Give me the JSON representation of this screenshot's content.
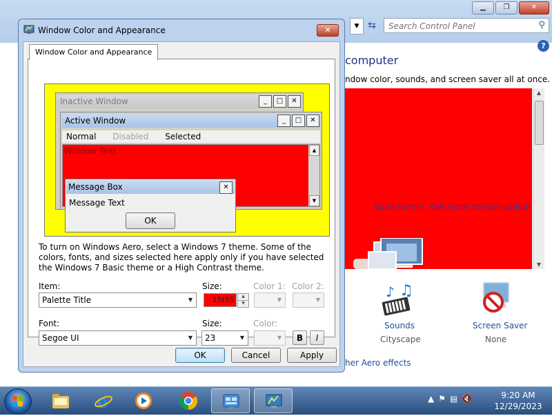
{
  "background_window": {
    "search_placeholder": "Search Control Panel",
    "heading_partial": "computer",
    "description_partial": "ndow color, sounds, and screen saver all at once.",
    "theme_links": [
      "Save theme",
      "Get more themes online"
    ],
    "sounds": {
      "label": "Sounds",
      "value": "Cityscape"
    },
    "screen_saver": {
      "label": "Screen Saver",
      "value": "None"
    },
    "aero_link_partial": "her Aero effects",
    "help_glyph": "?"
  },
  "dialog": {
    "title": "Window Color and Appearance",
    "tab_label": "Window Color and Appearance",
    "preview": {
      "inactive_window_title": "Inactive Window",
      "active_window_title": "Active Window",
      "menu_normal": "Normal",
      "menu_disabled": "Disabled",
      "menu_selected": "Selected",
      "window_text": "Window Text",
      "message_box_title": "Message Box",
      "message_text": "Message Text",
      "ok_label": "OK"
    },
    "info_text": "To turn on Windows Aero, select a Windows 7 theme.  Some of the colors, fonts, and sizes selected here apply only if you have selected the Windows 7 Basic theme or a High Contrast theme.",
    "item_label": "Item:",
    "item_value": "Palette Title",
    "item_size_label": "Size:",
    "item_size_value": "15t55",
    "color1_label": "Color 1:",
    "color2_label": "Color 2:",
    "font_label": "Font:",
    "font_value": "Segoe UI",
    "font_size_label": "Size:",
    "font_size_value": "23",
    "font_color_label": "Color:",
    "bold_label": "B",
    "italic_label": "I",
    "buttons": {
      "ok": "OK",
      "cancel": "Cancel",
      "apply": "Apply"
    }
  },
  "taskbar": {
    "time": "9:20 AM",
    "date": "12/29/2023",
    "pinned": [
      "windows-explorer-icon",
      "internet-explorer-icon",
      "media-player-icon",
      "chrome-icon",
      "control-panel-icon",
      "display-settings-icon"
    ]
  },
  "colors": {
    "preview_background": "#ffff00",
    "window_text_area": "#ff0000",
    "theme_preview": "#ff0000",
    "size_field": "#ff0000"
  }
}
